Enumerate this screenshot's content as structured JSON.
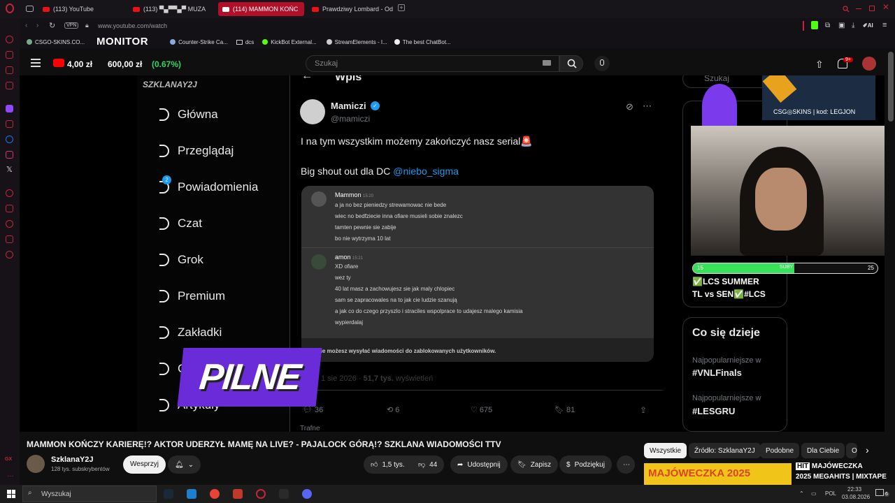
{
  "tabs": [
    {
      "label": "(113) YouTube"
    },
    {
      "label": "(113) ▀▄▀▀▄▀ MUZA"
    },
    {
      "label": "(114) MAMMON KOŃC"
    },
    {
      "label": "Prawdziwy Lombard - Odc"
    }
  ],
  "address": {
    "vpn": "VPN",
    "url": "www.youtube.com/watch",
    "ai": "AI"
  },
  "bookmarks": [
    "CSGO-SKINS.CO...",
    "Counter-Strike Ca...",
    "dcs",
    "KickBot External...",
    "StreamElements - I...",
    "The best ChatBot..."
  ],
  "overlay": {
    "monitor": "MONITOR",
    "ticker_value": "600,00 zł",
    "ticker_change": "(0.67%)",
    "ticker_prefix": "4,00 zł"
  },
  "yt": {
    "search_placeholder": "Szukaj",
    "notif_badge": "9+"
  },
  "x_nav": {
    "logo": "SZKLANAY2J",
    "items": [
      "Główna",
      "Przeglądaj",
      "Powiadomienia",
      "Czat",
      "Grok",
      "Premium",
      "Zakładki",
      "Cre",
      "Artykuły"
    ],
    "notif_count": "2"
  },
  "tweet": {
    "header": "Wpis",
    "author": "Mamiczi",
    "handle": "@mamiczi",
    "text1": "I na tym wszystkim możemy zakończyć nasz serial🚨",
    "text2_prefix": "Big shout out dla DC ",
    "text2_mention": "@niebo_sigma",
    "meta_time": "1 sie 2026",
    "meta_views": "51,7 tys.",
    "meta_views_label": "wyświetleń",
    "stats": {
      "replies": "36",
      "reposts": "6",
      "likes": "675",
      "bookmarks": "81"
    },
    "more": "Trafne"
  },
  "dm": {
    "mammon_name": "Mammon",
    "mammon_time": "15:20",
    "mammon_lines": [
      "a ja no bez pieniedzy strewamowac nie bede",
      "wiec no bedfziecie inna ofiare musieli sobie znalezc",
      "tamten pewnie sie zabije",
      "bo nie wytrzyma 10 lat"
    ],
    "amon_name": "amon",
    "amon_time": "15:21",
    "amon_lines": [
      "XD ofiare",
      "wez ty",
      "40 lat masz a zachowujesz sie jak maly chlopiec",
      "sam se zapracowales na to jak cie ludzie szanują",
      "a jak co do czego przyszlo i straciles wspolprace to udajesz malego kamisia",
      "wypierdalaj"
    ],
    "blocked": "Nie możesz wysyłać wiadomości do zablokowanych użytkowników."
  },
  "right_col": {
    "search": "Szukaj",
    "heading": "Co się dzieje",
    "trend_label": "Najpopularniejsze w",
    "trend1": "#VNLFinals",
    "trend2": "#LESGRU",
    "lcs1": "✅LCS SUMMER",
    "lcs2": "TL vs SEN✅#LCS"
  },
  "stream_overlay": {
    "csgo": "CSG◎SKINS | kod: LEGJON",
    "bar_left": "15",
    "bar_mid": "SUBY",
    "bar_right": "25",
    "bar_progress": 0.55
  },
  "pilne": "PILNE",
  "video_title": "MAMMON KOŃCZY KARIERĘ!? AKTOR UDERZYŁ MAMĘ NA LIVE? - PAJALOCK GÓRĄ!? SZKLANA WIADOMOŚCI TTV",
  "channel": {
    "name": "SzklanaY2J",
    "subs": "128 tys. subskrybentów",
    "support": "Wesprzyj"
  },
  "actions": {
    "likes": "1,5 tys.",
    "dislikes": "44",
    "share": "Udostępnij",
    "save": "Zapisz",
    "thanks": "Podziękuj"
  },
  "chips": [
    "Wszystkie",
    "Źródło: SzklanaY2J",
    "Podobne",
    "Dla Ciebie",
    "O"
  ],
  "reco": {
    "title1": "MAJÓWECZKA",
    "title2": "2025 MEGAHITS | MIXTAPE",
    "thumb": "MAJÓWECZKA 2025",
    "hit": "HIT"
  },
  "taskbar": {
    "search": "Wyszukaj",
    "lang": "POL",
    "time": "22:33",
    "date": "03.08.2026",
    "notif": "6"
  },
  "colors": {
    "opera_red": "#c4253d",
    "yt_red": "#ff0000",
    "x_blue": "#1d9bf0",
    "ticker_green": "#2fd36a",
    "pilne_purple": "#6a2bd9",
    "bar_green": "#39e05a"
  }
}
